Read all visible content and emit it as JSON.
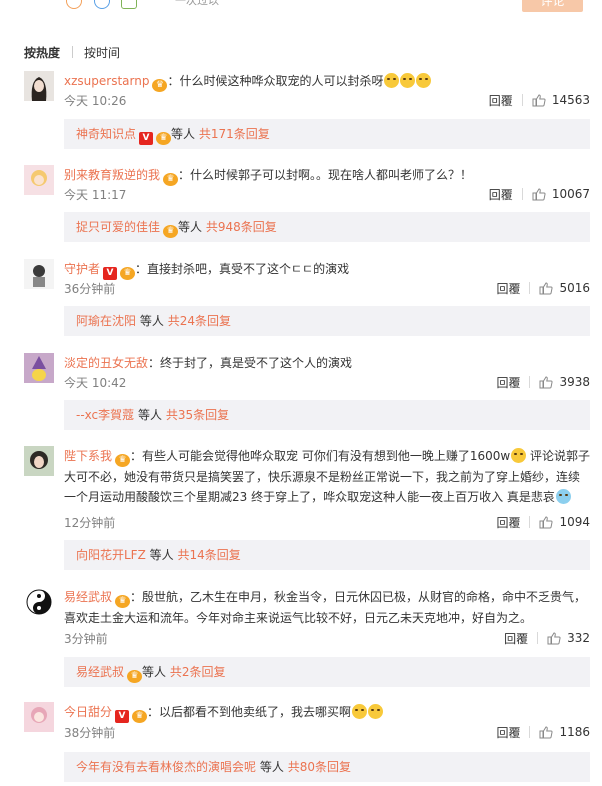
{
  "top": {
    "label": "评论",
    "truncated_text": "一次过以"
  },
  "tabs": [
    {
      "label": "按热度"
    },
    {
      "label": "按时间"
    }
  ],
  "comments": [
    {
      "username": "xzsuperstarnp",
      "text": "：什么时候这种哗众取宠的人可以封杀呀",
      "time": "今天 10:26",
      "reply": "回覆",
      "likes": "14563",
      "sub": {
        "name": "神奇知识点",
        "suffix": "等人",
        "count": "共171条回复"
      }
    },
    {
      "username": "别来教育叛逆的我",
      "text": "：什么时候郭子可以封啊。。现在啥人都叫老师了么？！",
      "time": "今天 11:17",
      "reply": "回覆",
      "likes": "10067",
      "sub": {
        "name": "捉只可爱的佳佳",
        "suffix": "等人",
        "count": "共948条回复"
      }
    },
    {
      "username": "守护者",
      "text": "：直接封杀吧，真受不了这个ㄷㄷ的演戏",
      "time": "36分钟前",
      "reply": "回覆",
      "likes": "5016",
      "sub": {
        "name": "阿瑜在沈阳",
        "suffix": "等人",
        "count": "共24条回复"
      }
    },
    {
      "username": "淡定的丑女无敌",
      "text": "：终于封了，真是受不了这个人的演戏",
      "time": "今天 10:42",
      "reply": "回覆",
      "likes": "3938",
      "sub": {
        "name": "--xc李賀蔻",
        "suffix": "等人",
        "count": "共35条回复"
      }
    },
    {
      "username": "陛下系我",
      "text": "：有些人可能会觉得他哗众取宠 可你们有没有想到他一晚上赚了1600w",
      "text2": " 评论说郭子大可不必，她没有带货只是搞笑罢了，快乐源泉不是粉丝正常说一下，我之前为了穿上婚纱，连续一个月运动用酸酸饮三个星期减23 终于穿上了，哗众取宠这种人能一夜上百万收入 真是悲哀",
      "time": "12分钟前",
      "reply": "回覆",
      "likes": "1094",
      "sub": {
        "name": "向阳花开LFZ",
        "suffix": "等人",
        "count": "共14条回复"
      }
    },
    {
      "username": "易经武叔",
      "text": "：殷世航，乙木生在申月，秋金当令，日元休囚已极，从财官的命格，命中不乏贵气，喜欢走土金大运和流年。今年对命主来说运气比较不好，日元乙未天克地冲，好自为之。",
      "time": "3分钟前",
      "reply": "回覆",
      "likes": "332",
      "sub": {
        "name": "易经武叔",
        "suffix": "等人",
        "count": "共2条回复"
      }
    },
    {
      "username": "今日甜分",
      "text": "：以后都看不到他卖纸了，我去哪买啊",
      "time": "38分钟前",
      "reply": "回覆",
      "likes": "1186",
      "sub": {
        "name": "今年有没有去看林俊杰的演唱会呢",
        "suffix": "等人",
        "count": "共80条回复"
      }
    }
  ],
  "colors": {
    "accent": "#eb7350",
    "sub_bg": "#f2f2f5",
    "meta": "#808080"
  }
}
